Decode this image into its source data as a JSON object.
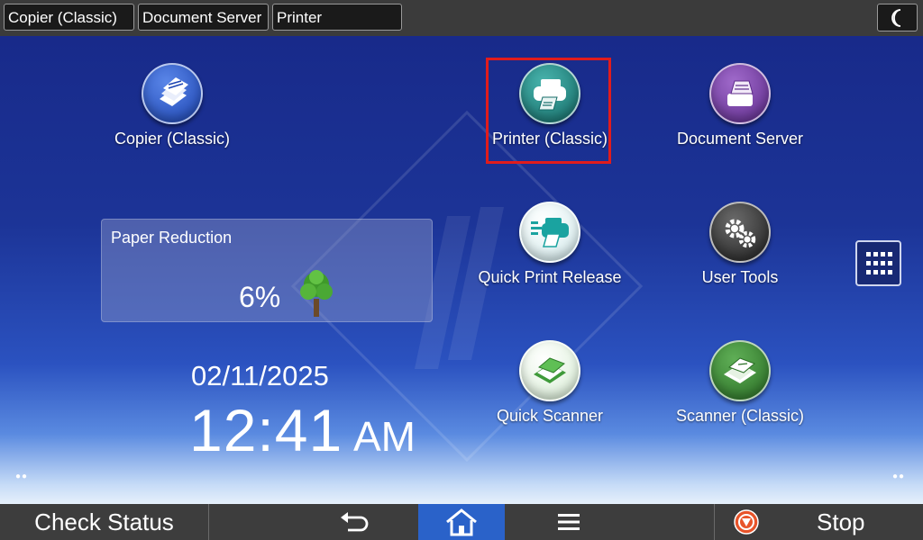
{
  "topbar": {
    "tabs": [
      "Copier (Classic)",
      "Document Server",
      "Printer"
    ],
    "night_icon": "moon-icon"
  },
  "apps": [
    {
      "label": "Copier (Classic)",
      "icon": "copier-icon",
      "color": "#2c56c8"
    },
    {
      "label": "Printer (Classic)",
      "icon": "printer-icon",
      "color": "#1f8a85"
    },
    {
      "label": "Document Server",
      "icon": "document-server-icon",
      "color": "#7a3fa6"
    },
    {
      "label": "Quick Print Release",
      "icon": "quick-print-release-icon",
      "color": "#1aa3a0"
    },
    {
      "label": "User Tools",
      "icon": "gears-icon",
      "color": "#3a3a3a"
    },
    {
      "label": "Quick Scanner",
      "icon": "quick-scanner-icon",
      "color": "#3f9a3a"
    },
    {
      "label": "Scanner (Classic)",
      "icon": "scanner-icon",
      "color": "#2f7d2a"
    }
  ],
  "paper_reduction": {
    "title": "Paper Reduction",
    "value": "6%"
  },
  "clock": {
    "date": "02/11/2025",
    "time": "12:41",
    "ampm": "AM"
  },
  "bottombar": {
    "check_status": "Check Status",
    "stop": "Stop",
    "back_icon": "back-icon",
    "home_icon": "home-icon",
    "menu_icon": "menu-icon",
    "stop_icon": "stop-icon"
  },
  "colors": {
    "highlight": "#e11c1c",
    "home_active": "#2a62c9"
  }
}
